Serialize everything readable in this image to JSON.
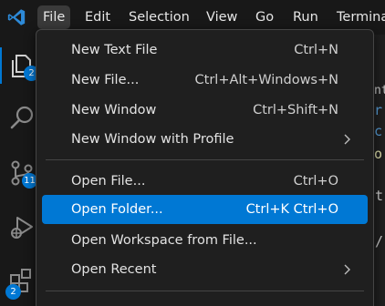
{
  "menubar": {
    "logo_icon": "vscode-logo-icon",
    "items": [
      {
        "label": "File"
      },
      {
        "label": "Edit"
      },
      {
        "label": "Selection"
      },
      {
        "label": "View"
      },
      {
        "label": "Go"
      },
      {
        "label": "Run"
      },
      {
        "label": "Terminal"
      }
    ],
    "active_item": "File"
  },
  "activitybar": {
    "icons": [
      {
        "name": "explorer-icon",
        "badge": "2"
      },
      {
        "name": "search-icon"
      },
      {
        "name": "source-control-icon",
        "badge": "11"
      },
      {
        "name": "run-debug-icon"
      },
      {
        "name": "extensions-icon",
        "badge": "2"
      }
    ]
  },
  "editor_fragments": [
    {
      "text": "nt",
      "color": "#c8c8c8"
    },
    {
      "text": "r",
      "color": "#569cd6"
    },
    {
      "text": "c",
      "color": "#569cd6"
    },
    {
      "text": "o",
      "color": "#dcdcaa"
    },
    {
      "text": "t",
      "color": "#c8c8c8"
    },
    {
      "text": "/",
      "color": "#c8c8c8"
    }
  ],
  "file_menu": {
    "groups": [
      [
        {
          "label": "New Text File",
          "shortcut": "Ctrl+N"
        },
        {
          "label": "New File...",
          "shortcut": "Ctrl+Alt+Windows+N"
        },
        {
          "label": "New Window",
          "shortcut": "Ctrl+Shift+N"
        },
        {
          "label": "New Window with Profile",
          "shortcut": "",
          "submenu": true
        }
      ],
      [
        {
          "label": "Open File...",
          "shortcut": "Ctrl+O"
        },
        {
          "label": "Open Folder...",
          "shortcut": "Ctrl+K Ctrl+O",
          "highlighted": true
        },
        {
          "label": "Open Workspace from File...",
          "shortcut": ""
        },
        {
          "label": "Open Recent",
          "shortcut": "",
          "submenu": true
        }
      ]
    ],
    "highlight_color": "#0078d4"
  }
}
